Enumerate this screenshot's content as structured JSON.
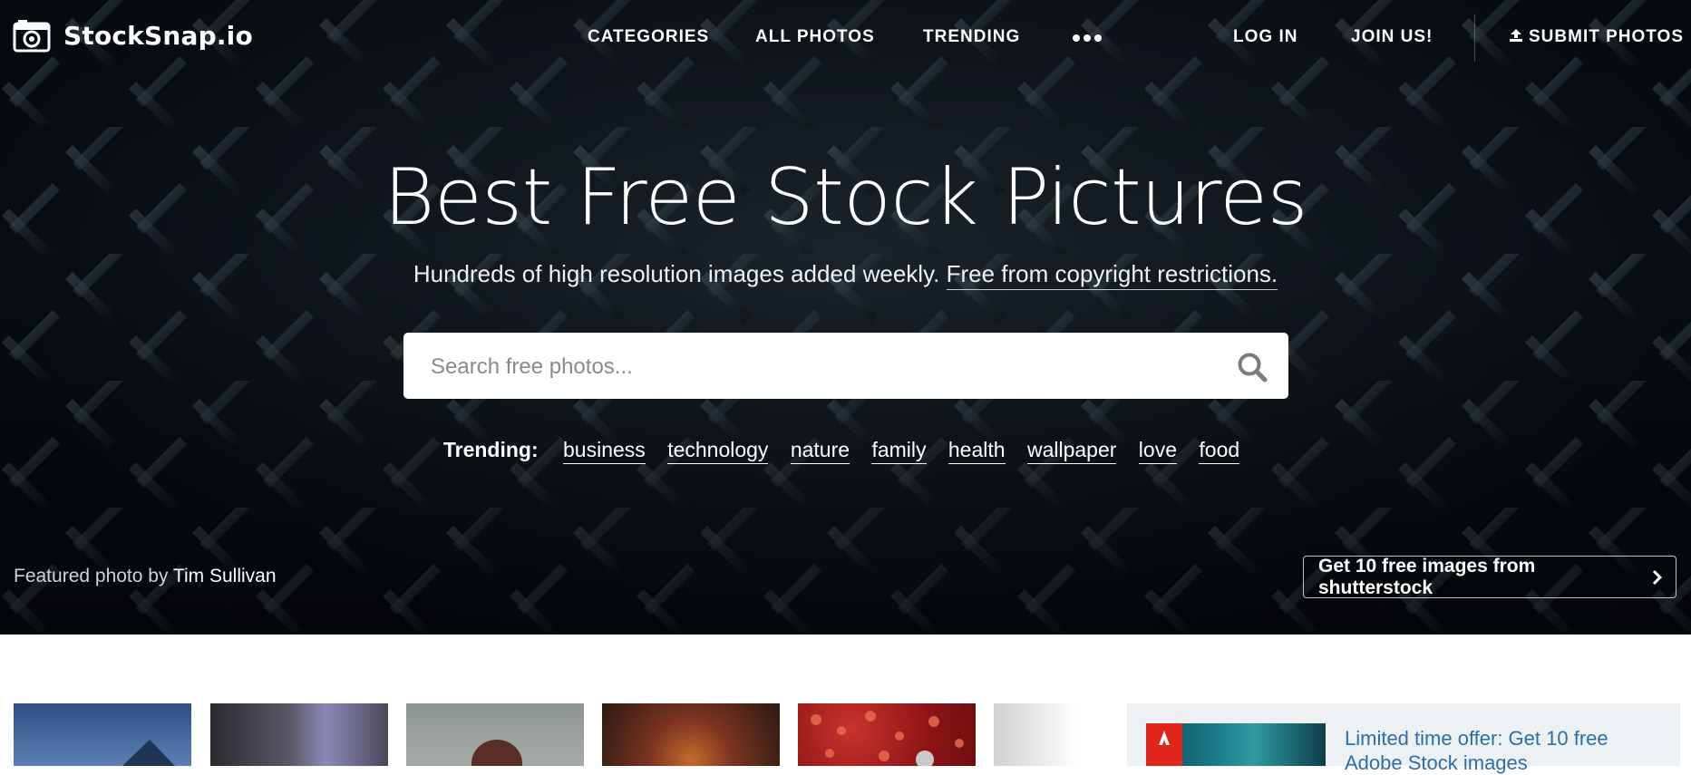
{
  "brand": {
    "name": "StockSnap.io"
  },
  "nav": {
    "categories": "CATEGORIES",
    "all_photos": "ALL PHOTOS",
    "trending": "TRENDING",
    "log_in": "LOG IN",
    "join": "JOIN US!",
    "submit": "SUBMIT PHOTOS"
  },
  "hero": {
    "title": "Best Free Stock Pictures",
    "subtitle": "Hundreds of high resolution images added weekly.",
    "subtitle_link": "Free from copyright restrictions."
  },
  "search": {
    "placeholder": "Search free photos..."
  },
  "trending": {
    "label": "Trending:",
    "tags": [
      "business",
      "technology",
      "nature",
      "family",
      "health",
      "wallpaper",
      "love",
      "food"
    ]
  },
  "featured": {
    "prefix": "Featured photo by",
    "author": "Tim Sullivan"
  },
  "promo": {
    "label": "Get 10 free images from shutterstock"
  },
  "ad": {
    "text": "Limited time offer: Get 10 free Adobe Stock images"
  },
  "colors": {
    "hero_bg": "#0d1419",
    "ad_link": "#2c6fa8",
    "ad_bg": "#eef1f4"
  },
  "icons": [
    "camera-icon",
    "more-dots-icon",
    "upload-icon",
    "search-icon",
    "chevron-right-icon"
  ]
}
